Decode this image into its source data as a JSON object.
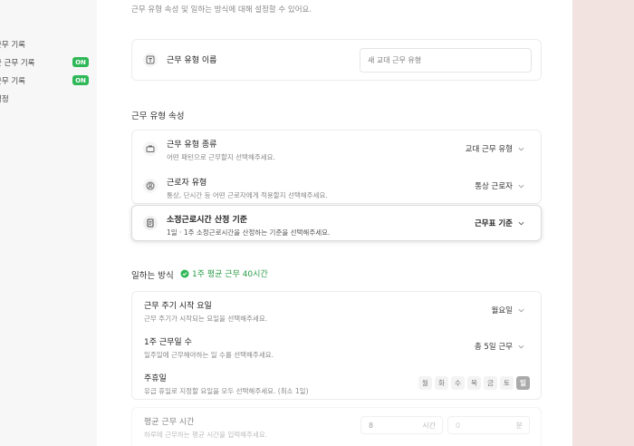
{
  "sidebar": {
    "items": [
      {
        "label": "근무 기록"
      },
      {
        "label": "근 근무 기록",
        "badge": "ON"
      },
      {
        "label": "근무 기록",
        "badge": "ON"
      },
      {
        "label": "설정"
      }
    ]
  },
  "main": {
    "top_desc": "근무 유형 속성 및 일하는 방식에 대해 설정할 수 있어요.",
    "name_row": {
      "label": "근무 유형 이름",
      "placeholder": "새 교대 근무 유형"
    },
    "attr_section_title": "근무 유형 속성",
    "attrs": [
      {
        "title": "근무 유형 종류",
        "sub": "어떤 패턴으로 근무할지 선택해주세요.",
        "value": "교대 근무 유형"
      },
      {
        "title": "근로자 유형",
        "sub": "통상, 단시간 등 어떤 근로자에게 적용할지 선택해주세요.",
        "value": "통상 근로자"
      },
      {
        "title": "소정근로시간 산정 기준",
        "sub": "1일 · 1주 소정근로시간을 산정하는 기준을 선택해주세요.",
        "value": "근무표 기준"
      }
    ],
    "work_section_title": "일하는 방식",
    "work_badge": "1주 평균 근무 40시간",
    "work_rows": [
      {
        "title": "근무 주기 시작 요일",
        "sub": "근무 주기가 시작되는 요일을 선택해주세요.",
        "value": "월요일"
      },
      {
        "title": "1주 근무일 수",
        "sub": "일주일에 근무해야하는 일 수를 선택해주세요.",
        "value": "총 5일 근무"
      },
      {
        "title": "주휴일",
        "sub": "유급 휴일로 지정할 요일을 모두 선택해주세요. (최소 1일)"
      }
    ],
    "days": [
      "월",
      "화",
      "수",
      "목",
      "금",
      "토",
      "일"
    ],
    "selected_day": "일",
    "avg_row": {
      "title": "평균 근무 시간",
      "sub": "하루에 근무하는 평균 시간을 입력해주세요.",
      "hours": "8",
      "hours_unit": "시간",
      "minutes": "0",
      "minutes_unit": "분"
    }
  },
  "colors": {
    "accent_green": "#2fb857",
    "badge_green_text": "#2a9d4a"
  }
}
